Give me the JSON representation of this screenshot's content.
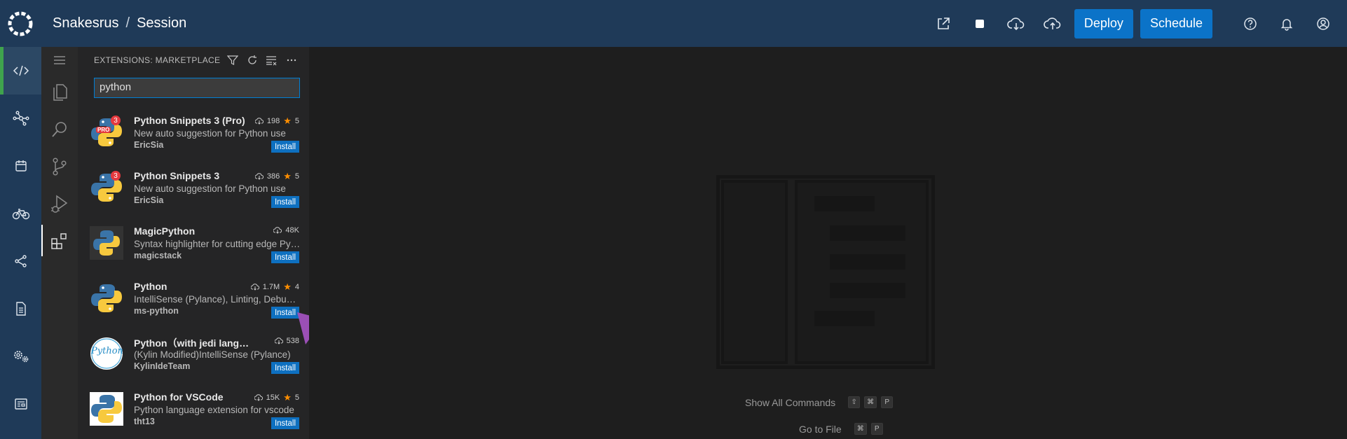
{
  "header": {
    "breadcrumb": [
      "Snakesrus",
      "Session"
    ],
    "separator": "/",
    "deploy_label": "Deploy",
    "schedule_label": "Schedule",
    "icons": [
      "open-external-icon",
      "stop-icon",
      "cloud-download-icon",
      "cloud-upload-icon",
      "help-icon",
      "bell-icon",
      "user-icon"
    ],
    "background": "#1f3a58",
    "accent": "#0b73c8"
  },
  "rail": {
    "items": [
      "code-icon",
      "network-icon",
      "calendar-icon",
      "bike-icon",
      "share-icon",
      "document-icon",
      "settings-gear-icon",
      "news-icon"
    ],
    "active_index": 0,
    "active_color": "#3fa34d"
  },
  "activity_bar": {
    "items": [
      "menu-icon",
      "explorer-icon",
      "search-icon",
      "source-control-icon",
      "run-debug-icon",
      "extensions-icon"
    ],
    "active": "extensions-icon"
  },
  "extensions_panel": {
    "title": "EXTENSIONS: MARKETPLACE",
    "search_value": "python",
    "tools": [
      "filter-icon",
      "refresh-icon",
      "clear-icon",
      "more-icon"
    ],
    "items": [
      {
        "title": "Python Snippets 3 (Pro)",
        "downloads": "198",
        "rating": "5",
        "description": "New auto suggestion for Python use",
        "publisher": "EricSia",
        "action": "Install",
        "badge": "3",
        "pro": "PRO"
      },
      {
        "title": "Python Snippets 3",
        "downloads": "386",
        "rating": "5",
        "description": "New auto suggestion for Python use",
        "publisher": "EricSia",
        "action": "Install",
        "badge": "3"
      },
      {
        "title": "MagicPython",
        "downloads": "48K",
        "rating": "",
        "description": "Syntax highlighter for cutting edge Python",
        "publisher": "magicstack",
        "action": "Install"
      },
      {
        "title": "Python",
        "downloads": "1.7M",
        "rating": "4",
        "description": "IntelliSense (Pylance), Linting, Debugging",
        "publisher": "ms-python",
        "action": "Install"
      },
      {
        "title": "Python（with jedi language server）",
        "downloads": "538",
        "rating": "",
        "description": "(Kylin Modified)IntelliSense (Pylance)",
        "publisher": "KylinIdeTeam",
        "action": "Install",
        "icon_text": "Python"
      },
      {
        "title": "Python for VSCode",
        "downloads": "15K",
        "rating": "5",
        "description": "Python language extension for vscode",
        "publisher": "tht13",
        "action": "Install"
      }
    ]
  },
  "editor": {
    "shortcuts": [
      {
        "label": "Show All Commands",
        "keys": [
          "⇧",
          "⌘",
          "P"
        ]
      },
      {
        "label": "Go to File",
        "keys": [
          "⌘",
          "P"
        ]
      }
    ]
  },
  "annotation": {
    "arrow_color": "#9b4fb6"
  }
}
